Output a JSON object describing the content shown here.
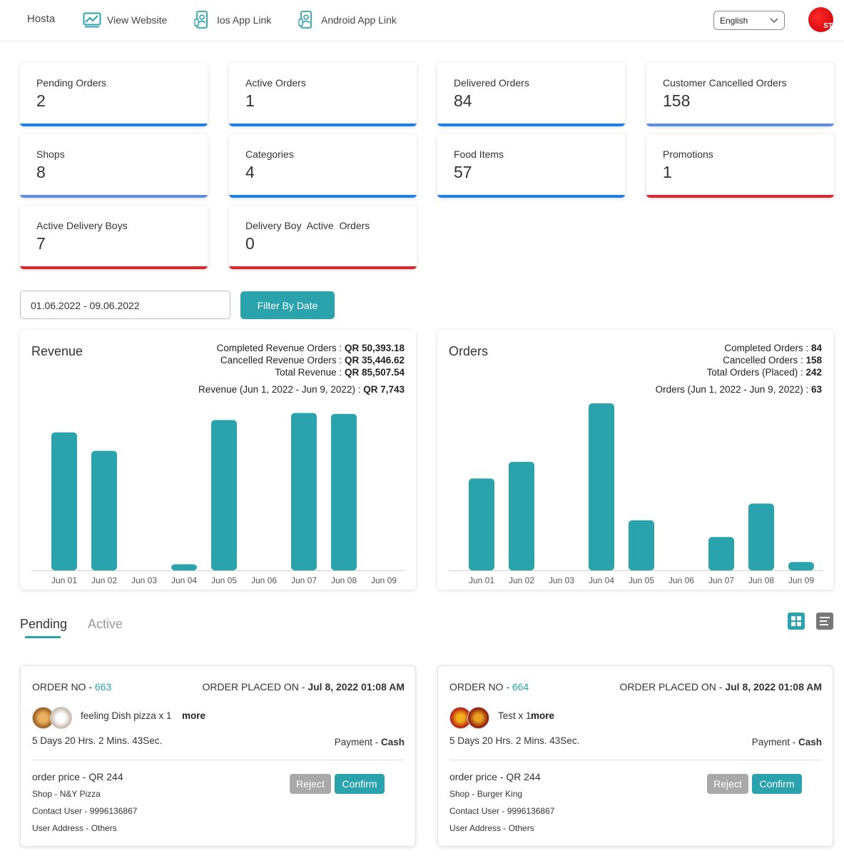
{
  "header": {
    "brand": "Hosta",
    "links": [
      {
        "label": "View Website",
        "icon": "website-icon"
      },
      {
        "label": "Ios App Link",
        "icon": "mobile-app-icon"
      },
      {
        "label": "Android App Link",
        "icon": "mobile-app-icon"
      }
    ],
    "language": "English",
    "avatar_text": "ST"
  },
  "stats": [
    {
      "label": "Pending Orders",
      "value": "2",
      "color": "#1a7ff0"
    },
    {
      "label": "Active Orders",
      "value": "1",
      "color": "#1a7ff0"
    },
    {
      "label": "Delivered Orders",
      "value": "84",
      "color": "#1a7ff0"
    },
    {
      "label": "Customer Cancelled Orders",
      "value": "158",
      "color": "#5b8ee8"
    },
    {
      "label": "Shops",
      "value": "8",
      "color": "#5b8ee8"
    },
    {
      "label": "Categories",
      "value": "4",
      "color": "#1a7ff0"
    },
    {
      "label": "Food Items",
      "value": "57",
      "color": "#1a7ff0"
    },
    {
      "label": "Promotions",
      "value": "1",
      "color": "#e52227"
    },
    {
      "label": "Active Delivery Boys",
      "value": "7",
      "color": "#e52227"
    },
    {
      "label": "Delivery Boy  Active  Orders",
      "value": "0",
      "color": "#e52227"
    }
  ],
  "filter": {
    "date_range": "01.06.2022 - 09.06.2022",
    "button_label": "Filter By Date"
  },
  "revenue_panel": {
    "title": "Revenue",
    "completed_label": "Completed Revenue Orders : ",
    "completed_value": "QR 50,393.18",
    "cancelled_label": "Cancelled Revenue Orders : ",
    "cancelled_value": "QR 35,446.62",
    "total_label": "Total Revenue : ",
    "total_value": "QR 85,507.54",
    "range_label": "Revenue (Jun 1, 2022 - Jun 9, 2022) : ",
    "range_value": "QR 7,743"
  },
  "orders_panel": {
    "title": "Orders",
    "completed_label": "Completed Orders : ",
    "completed_value": "84",
    "cancelled_label": "Cancelled Orders : ",
    "cancelled_value": "158",
    "total_label": "Total Orders (Placed) : ",
    "total_value": "242",
    "range_label": "Orders (Jun 1, 2022 - Jun 9, 2022) : ",
    "range_value": "63"
  },
  "chart_data": [
    {
      "type": "bar",
      "title": "Revenue",
      "categories": [
        "Jun 01",
        "Jun 02",
        "Jun 03",
        "Jun 04",
        "Jun 05",
        "Jun 06",
        "Jun 07",
        "Jun 08",
        "Jun 09"
      ],
      "values": [
        1570,
        1360,
        0,
        70,
        1710,
        0,
        1790,
        1780,
        0
      ],
      "ylim": [
        0,
        1900
      ],
      "color": "#2aa3ac",
      "grid": false
    },
    {
      "type": "bar",
      "title": "Orders",
      "categories": [
        "Jun 01",
        "Jun 02",
        "Jun 03",
        "Jun 04",
        "Jun 05",
        "Jun 06",
        "Jun 07",
        "Jun 08",
        "Jun 09"
      ],
      "values": [
        11,
        13,
        0,
        20,
        6,
        0,
        4,
        8,
        1
      ],
      "ylim": [
        0,
        20
      ],
      "color": "#2aa3ac",
      "grid": false
    }
  ],
  "tabs": [
    {
      "label": "Pending",
      "active": true
    },
    {
      "label": "Active",
      "active": false
    }
  ],
  "orders": [
    {
      "order_no_label": "ORDER NO - ",
      "order_no": "663",
      "placed_label": "ORDER PLACED ON - ",
      "placed_on": "Jul 8, 2022 01:08 AM",
      "item": "feeling Dish pizza x 1",
      "more": "more",
      "timer": "5 Days 20 Hrs. 2 Mins. 43Sec.",
      "payment_label": "Payment - ",
      "payment": "Cash",
      "price": "order price - QR 244",
      "shop": "Shop - N&Y Pizza",
      "contact": "Contact User - 9996136867",
      "address": "User Address - Others",
      "reject": "Reject",
      "confirm": "Confirm"
    },
    {
      "order_no_label": "ORDER NO - ",
      "order_no": "664",
      "placed_label": "ORDER PLACED ON - ",
      "placed_on": "Jul 8, 2022 01:08 AM",
      "item": "Test x 1",
      "more": "more",
      "timer": "5 Days 20 Hrs. 2 Mins. 43Sec.",
      "payment_label": "Payment - ",
      "payment": "Cash",
      "price": "order price - QR 244",
      "shop": "Shop - Burger King",
      "contact": "Contact User - 9996136867",
      "address": "User Address - Others",
      "reject": "Reject",
      "confirm": "Confirm"
    }
  ]
}
